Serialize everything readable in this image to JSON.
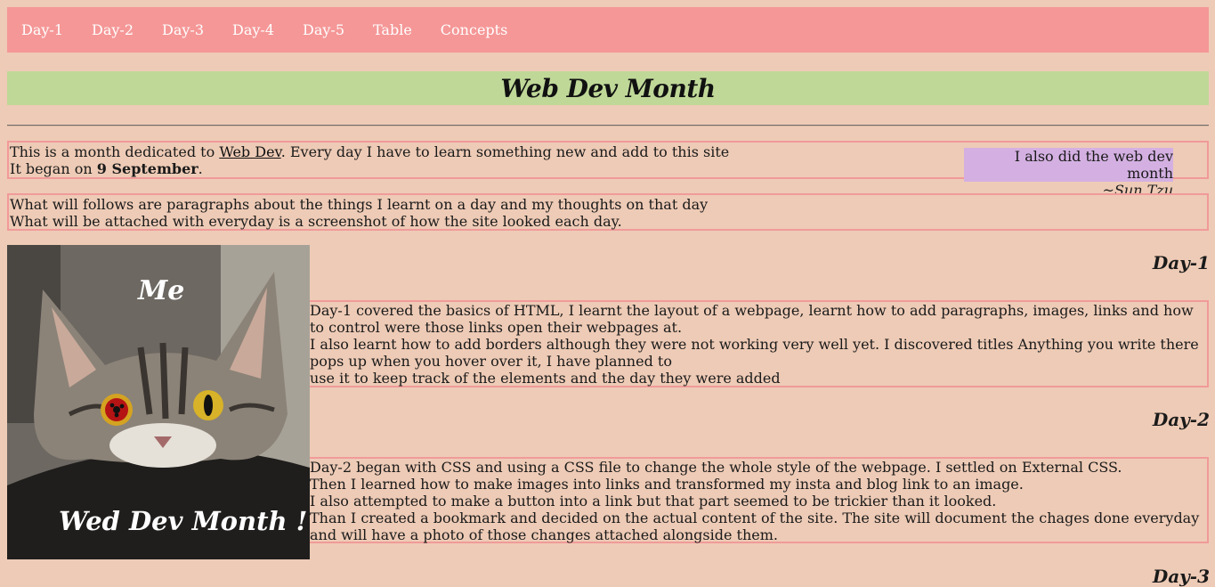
{
  "nav": {
    "items": [
      {
        "label": "Day-1"
      },
      {
        "label": "Day-2"
      },
      {
        "label": "Day-3"
      },
      {
        "label": "Day-4"
      },
      {
        "label": "Day-5"
      },
      {
        "label": "Table"
      },
      {
        "label": "Concepts"
      }
    ]
  },
  "header": {
    "title": "Web Dev Month"
  },
  "intro": {
    "line1_pre": "This is a month dedicated to ",
    "line1_link": "Web Dev",
    "line1_post": ". Every day I have to learn something new and add to this site",
    "line2_pre": "It began on ",
    "line2_bold": "9 September",
    "line2_post": "."
  },
  "quote": {
    "text": "I also did the web dev month",
    "cite": "~Sun Tzu"
  },
  "about": {
    "line1": "What will follows are paragraphs about the things I learnt on a day and my thoughts on that day",
    "line2": "What will be attached with everyday is a screenshot of how the site looked each day."
  },
  "image": {
    "top_text": "Me",
    "bottom_text": "Wed Dev Month !"
  },
  "days": [
    {
      "heading": "Day-1",
      "lines": [
        "Day-1 covered the basics of HTML, I learnt the layout of a webpage, learnt how to add paragraphs, images, links and how to control were those links open their webpages at.",
        "I also learnt how to add borders although they were not working very well yet. I discovered titles Anything you write there pops up when you hover over it, I have planned to",
        "use it to keep track of the elements and the day they were added"
      ]
    },
    {
      "heading": "Day-2",
      "lines": [
        "Day-2 began with CSS and using a CSS file to change the whole style of the webpage. I settled on External CSS.",
        "Then I learned how to make images into links and transformed my insta and blog link to an image.",
        "I also attempted to make a button into a link but that part seemed to be trickier than it looked.",
        "Than I created a bookmark and decided on the actual content of the site. The site will document the chages done everyday and will have a photo of those changes attached alongside them."
      ]
    },
    {
      "heading": "Day-3"
    }
  ],
  "colors": {
    "background": "#eecbb6",
    "nav_bg": "#f59797",
    "title_bg": "#bfd898",
    "quote_bg": "#d4b0e2",
    "border": "#f19a9a"
  }
}
